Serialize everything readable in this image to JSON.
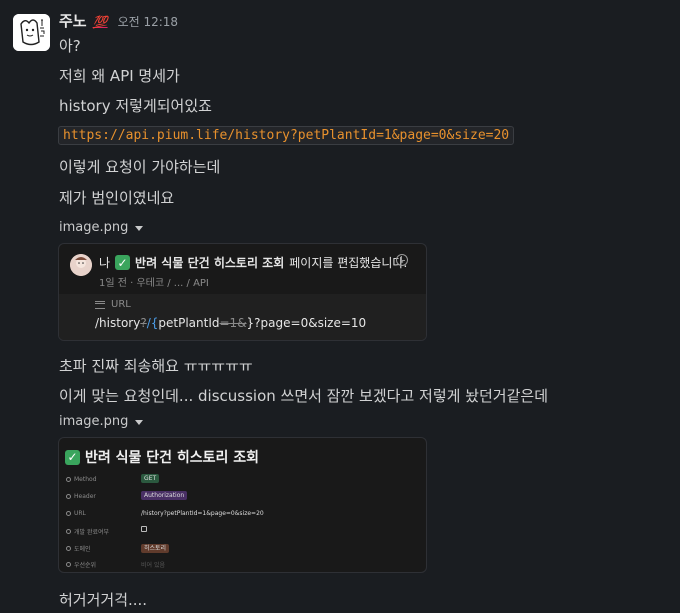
{
  "message": {
    "author": "주노",
    "author_emoji": "💯",
    "time": "오전 12:18",
    "lines": [
      "아?",
      "저희 왜 API 명세가",
      "history 저렇게되어있죠",
      "이렇게 요청이 가야하는데",
      "제가 범인이였네요",
      "초파 진짜 죄송해요 ㅠㅠㅠㅠㅠ",
      "이게 맞는 요청인데... discussion 쓰면서 잠깐 보겠다고 저렇게 놨던거같은데",
      "허거거거걱...."
    ],
    "code_url": "https://api.pium.life/history?petPlantId=1&page=0&size=20"
  },
  "attachment1": {
    "filename": "image.png",
    "notif_actor": "나",
    "notif_page": "반려 식물 단건 히스토리 조회",
    "notif_action": "페이지를 편집했습니다.",
    "notif_meta": "1일 전 · 우테코 / ... / API",
    "url_label": "URL",
    "url_parts": {
      "p1": "/history",
      "p2": "?",
      "p3": "/{",
      "p4": "petPlantId",
      "p5": "=1&",
      "p6": "}?page=0&size=10"
    }
  },
  "attachment2": {
    "filename": "image.png",
    "page_title": "반려 식물 단건 히스토리 조회",
    "properties": [
      {
        "label": "Method",
        "value": "GET"
      },
      {
        "label": "Header",
        "value": "Authorization"
      },
      {
        "label": "URL",
        "value": "/history?petPlantId=1&page=0&size=20"
      },
      {
        "label": "개발 완료여부",
        "value": ""
      },
      {
        "label": "도메인",
        "value": "히스토리"
      },
      {
        "label": "우선순위",
        "value": "비어 있음"
      }
    ]
  },
  "colors": {
    "background": "#1a1d21",
    "code_text": "#e8912d",
    "check_green": "#3aa55d"
  }
}
